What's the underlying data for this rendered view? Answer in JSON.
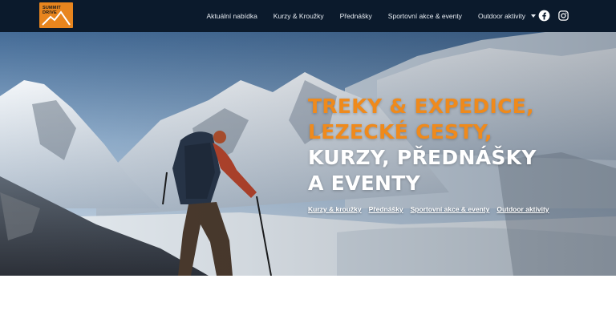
{
  "header": {
    "logo_text_line1": "SUMMIT",
    "logo_text_line2": "DRIVE",
    "nav": [
      {
        "label": "Aktuální nabídka"
      },
      {
        "label": "Kurzy & Kroužky"
      },
      {
        "label": "Přednášky"
      },
      {
        "label": "Sportovní akce & eventy"
      },
      {
        "label": "Outdoor aktivity",
        "dropdown": true
      }
    ],
    "social_icons": [
      "facebook-icon",
      "instagram-icon"
    ]
  },
  "hero": {
    "headline": [
      {
        "text": "TREKY & EXPEDICE,",
        "color": "#ef8a1c"
      },
      {
        "text": "LEZECKÉ CESTY,",
        "color": "#ef8a1c"
      },
      {
        "text": "KURZY, PŘEDNÁŠKY",
        "color": "#ffffff"
      },
      {
        "text": "A EVENTY",
        "color": "#ffffff"
      }
    ],
    "links": [
      {
        "label": "Kurzy & kroužky"
      },
      {
        "label": "Přednášky"
      },
      {
        "label": "Sportovní akce & eventy"
      },
      {
        "label": "Outdoor aktivity"
      }
    ]
  },
  "colors": {
    "navbar_bg": "#0b1a2c",
    "accent_orange": "#ef8a1c",
    "logo_bg": "#e8851e"
  }
}
